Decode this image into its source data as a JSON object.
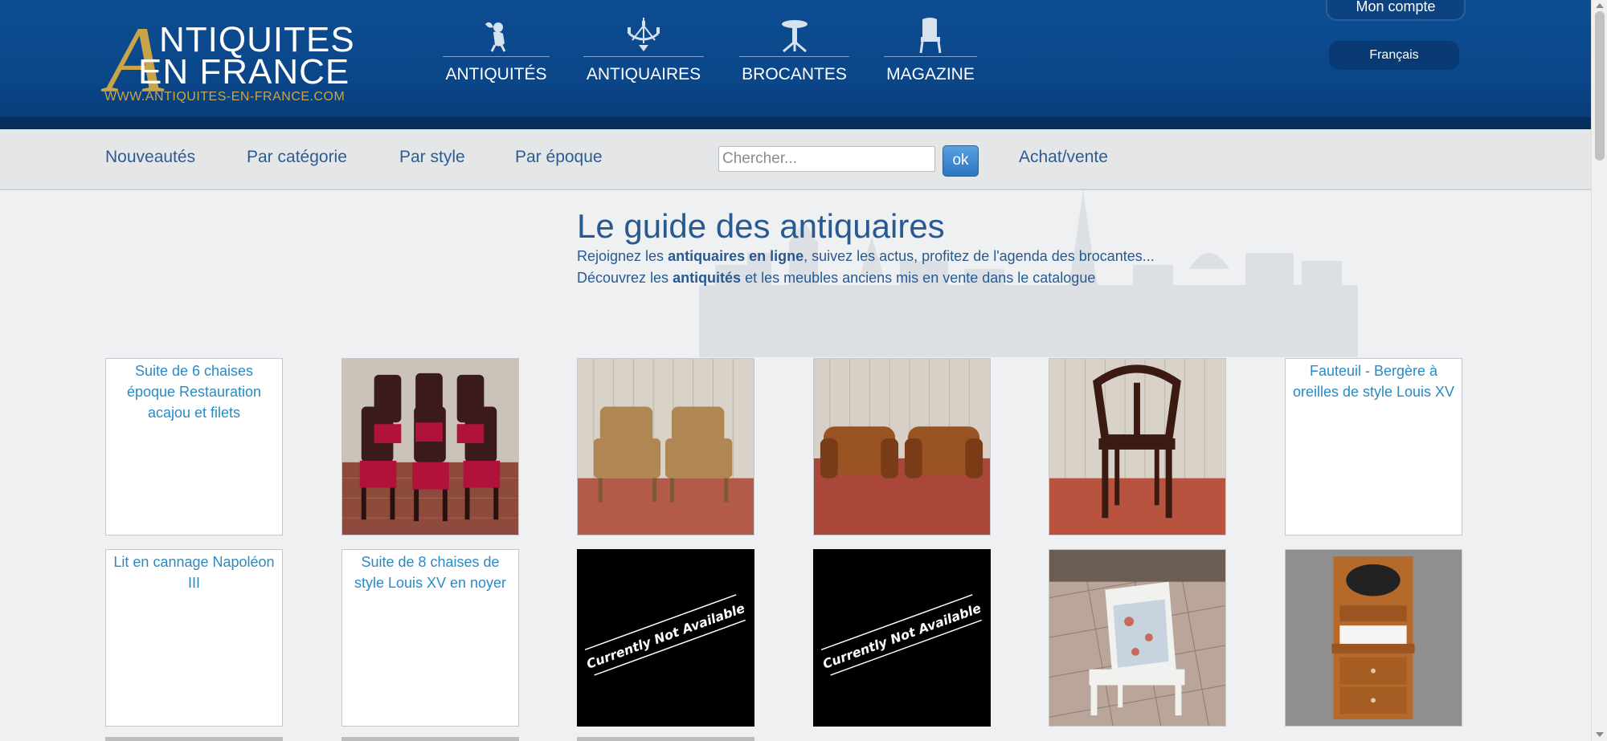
{
  "header": {
    "logo": {
      "big_letter": "A",
      "line1": "NTIQUITES",
      "line2": "EN FRANCE",
      "url": "WWW.ANTIQUITES-EN-FRANCE.COM"
    },
    "nav": [
      {
        "label": "ANTIQUITÉS",
        "icon": "cherub-icon"
      },
      {
        "label": "ANTIQUAIRES",
        "icon": "chandelier-icon"
      },
      {
        "label": "BROCANTES",
        "icon": "pedestal-table-icon"
      },
      {
        "label": "MAGAZINE",
        "icon": "chair-icon"
      }
    ],
    "account_label": "Mon compte",
    "language_label": "Français"
  },
  "subnav": {
    "links": [
      "Nouveautés",
      "Par catégorie",
      "Par style",
      "Par époque"
    ],
    "search_placeholder": "Chercher...",
    "search_button": "ok",
    "achat_vente": "Achat/vente"
  },
  "hero": {
    "title": "Le guide des antiquaires",
    "line1_pre": "Rejoignez les ",
    "line1_bold": "antiquaires en ligne",
    "line1_post": ", suivez les actus, profitez de l'agenda des brocantes...",
    "line2_pre": "Découvrez les ",
    "line2_bold": "antiquités",
    "line2_post": " et les meubles anciens mis en vente dans le catalogue"
  },
  "grid": {
    "row1": [
      {
        "type": "alt",
        "alt": "Suite de 6 chaises époque Restauration acajou et filets"
      },
      {
        "type": "photo",
        "subject": "six-red-chairs"
      },
      {
        "type": "photo",
        "subject": "pair-armchairs-tan"
      },
      {
        "type": "photo",
        "subject": "pair-leather-club-chairs"
      },
      {
        "type": "photo",
        "subject": "wooden-chair-back"
      },
      {
        "type": "alt",
        "alt": "Fauteuil - Bergère à oreilles de style Louis XV"
      }
    ],
    "row2": [
      {
        "type": "alt",
        "alt": "Lit en cannage Napoléon III"
      },
      {
        "type": "alt",
        "alt": "Suite de 8 chaises de style Louis XV en noyer"
      },
      {
        "type": "na",
        "text": "Currently Not Available"
      },
      {
        "type": "na",
        "text": "Currently Not Available"
      },
      {
        "type": "photo",
        "subject": "white-upholstered-armchair"
      },
      {
        "type": "photo",
        "subject": "wooden-washstand-cabinet"
      }
    ]
  }
}
